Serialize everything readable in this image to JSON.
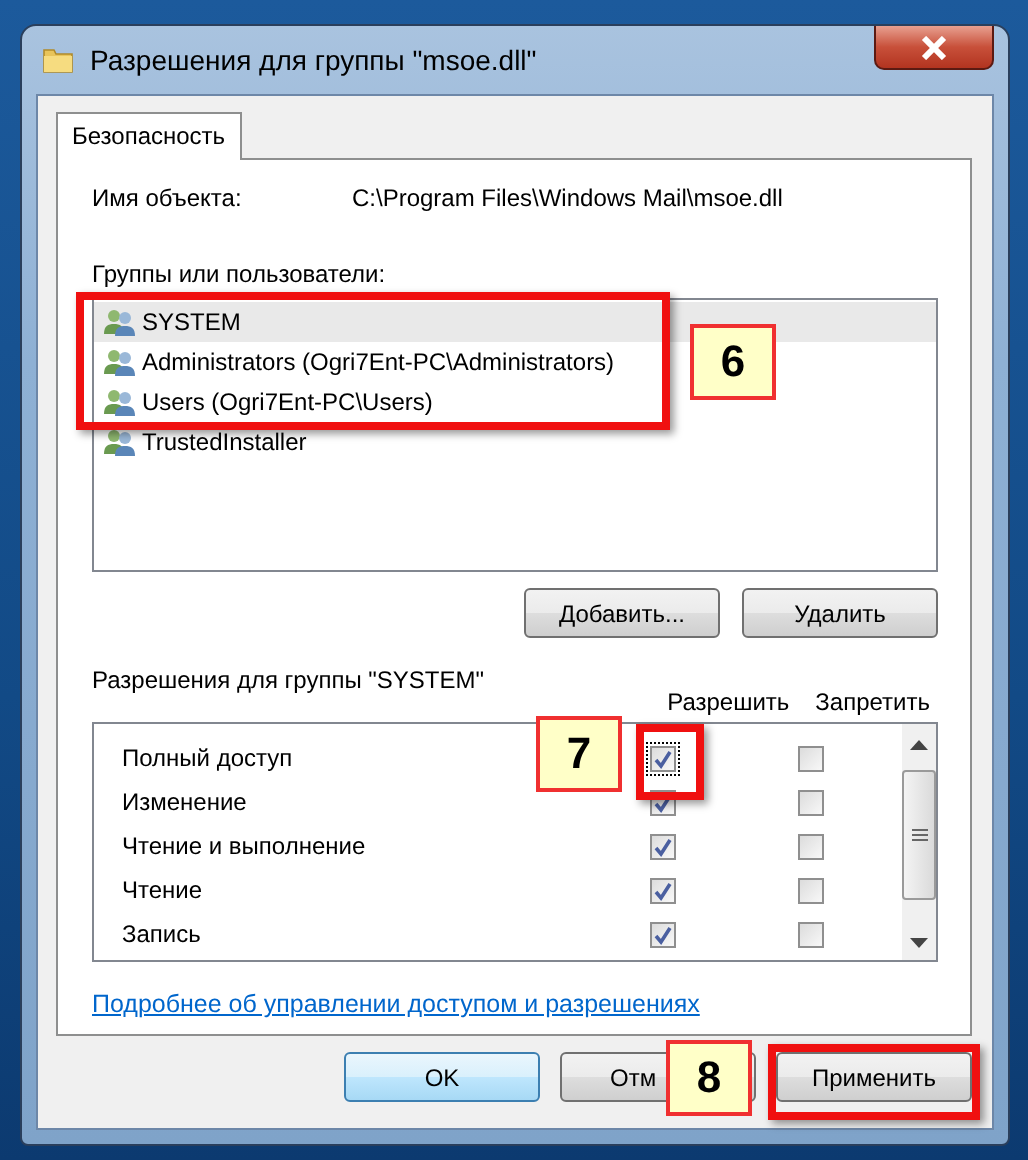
{
  "window": {
    "title": "Разрешения для группы \"msoe.dll\""
  },
  "tabs": [
    {
      "label": "Безопасность",
      "selected": true
    }
  ],
  "object": {
    "label": "Имя объекта:",
    "value": "C:\\Program Files\\Windows Mail\\msoe.dll"
  },
  "groups": {
    "label": "Группы или пользователи:",
    "items": [
      {
        "name": "SYSTEM",
        "selected": true
      },
      {
        "name": "Administrators (Ogri7Ent-PC\\Administrators)",
        "selected": false
      },
      {
        "name": "Users (Ogri7Ent-PC\\Users)",
        "selected": false
      },
      {
        "name": "TrustedInstaller",
        "selected": false
      }
    ],
    "buttons": [
      "Добавить...",
      "Удалить"
    ]
  },
  "permissions": {
    "label": "Разрешения для группы \"SYSTEM\"",
    "columns": [
      "Разрешить",
      "Запретить"
    ],
    "rows": [
      {
        "name": "Полный доступ",
        "allow": true,
        "deny": false,
        "focused": true
      },
      {
        "name": "Изменение",
        "allow": true,
        "deny": false,
        "focused": false
      },
      {
        "name": "Чтение и выполнение",
        "allow": true,
        "deny": false,
        "focused": false
      },
      {
        "name": "Чтение",
        "allow": true,
        "deny": false,
        "focused": false
      },
      {
        "name": "Запись",
        "allow": true,
        "deny": false,
        "focused": false
      }
    ]
  },
  "link": "Подробнее об управлении доступом и разрешениях",
  "buttons": [
    {
      "label": "OK",
      "default": true
    },
    {
      "label": "Отм",
      "default": false
    },
    {
      "label": "Применить",
      "default": false
    }
  ],
  "annotations": [
    {
      "label": "6"
    },
    {
      "label": "7"
    },
    {
      "label": "8"
    }
  ]
}
